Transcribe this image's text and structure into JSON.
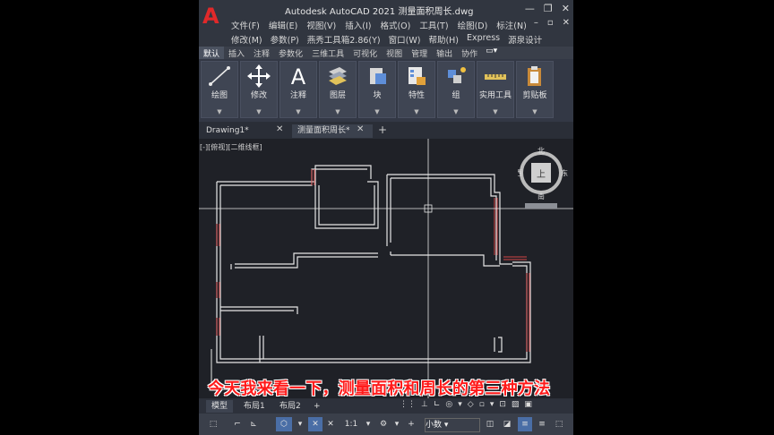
{
  "app": {
    "title": "Autodesk AutoCAD 2021   测量面积周长.dwg",
    "logo": "A"
  },
  "menu": {
    "row1": [
      "文件(F)",
      "编辑(E)",
      "视图(V)",
      "插入(I)",
      "格式(O)",
      "工具(T)",
      "绘图(D)",
      "标注(N)"
    ],
    "row2": [
      "修改(M)",
      "参数(P)",
      "燕秀工具箱2.86(Y)",
      "窗口(W)",
      "帮助(H)",
      "Express",
      "源泉设计"
    ]
  },
  "ribbon_tabs": [
    "默认",
    "插入",
    "注释",
    "参数化",
    "三维工具",
    "可视化",
    "视图",
    "管理",
    "输出",
    "协作"
  ],
  "ribbon_panels": [
    {
      "label": "绘图",
      "icon": "line-icon"
    },
    {
      "label": "修改",
      "icon": "move-icon"
    },
    {
      "label": "注释",
      "icon": "text-icon"
    },
    {
      "label": "图层",
      "icon": "layers-icon"
    },
    {
      "label": "块",
      "icon": "block-icon"
    },
    {
      "label": "特性",
      "icon": "properties-icon"
    },
    {
      "label": "组",
      "icon": "group-icon"
    },
    {
      "label": "实用工具",
      "icon": "measure-icon"
    },
    {
      "label": "剪贴板",
      "icon": "clipboard-icon"
    }
  ],
  "doc_tabs": [
    "Drawing1*",
    "测量面积周长*"
  ],
  "viewport_label": "[-][俯视][二维线框]",
  "viewcube": {
    "north": "北",
    "south": "南",
    "east": "东",
    "west": "西",
    "top": "上",
    "wcs": "WCS"
  },
  "layout_tabs": [
    "模型",
    "布局1",
    "布局2"
  ],
  "status": {
    "scale": "1:1",
    "units": "小数"
  },
  "subtitle": "今天我来看一下，测量面积和周长的第三种方法"
}
